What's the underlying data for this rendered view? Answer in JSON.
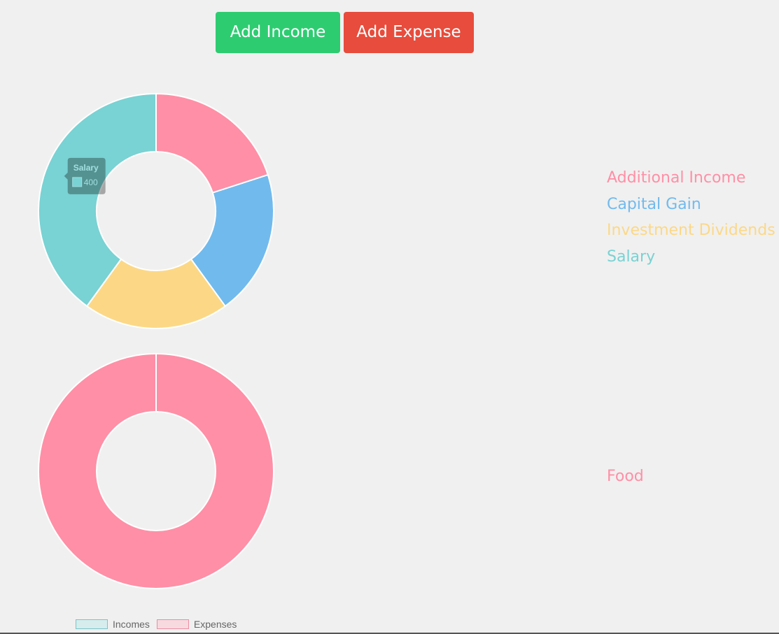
{
  "buttons": {
    "add_income": {
      "label": "Add Income",
      "color": "#2ecc71"
    },
    "add_expense": {
      "label": "Add Expense",
      "color": "#e74c3c"
    }
  },
  "chart_data": [
    {
      "type": "pie",
      "variant": "doughnut",
      "title": "",
      "categories": [
        "Additional Income",
        "Capital Gain",
        "Investment Dividends",
        "Salary"
      ],
      "values": [
        200,
        200,
        200,
        400
      ],
      "colors": [
        "#ff8fa6",
        "#71baed",
        "#fcd886",
        "#79d2d3"
      ],
      "legend_placement": "right",
      "tooltip": {
        "label": "Salary",
        "value": "400",
        "visible": true
      }
    },
    {
      "type": "pie",
      "variant": "doughnut",
      "title": "",
      "categories": [
        "Food"
      ],
      "values": [
        100
      ],
      "colors": [
        "#ff8fa6"
      ],
      "legend_placement": "right"
    }
  ],
  "bottom_legend": {
    "items": [
      {
        "label": "Incomes",
        "fill": "#d6eced",
        "border": "#79c5c8"
      },
      {
        "label": "Expenses",
        "fill": "#f7d9e0",
        "border": "#ea8fa3"
      }
    ]
  }
}
